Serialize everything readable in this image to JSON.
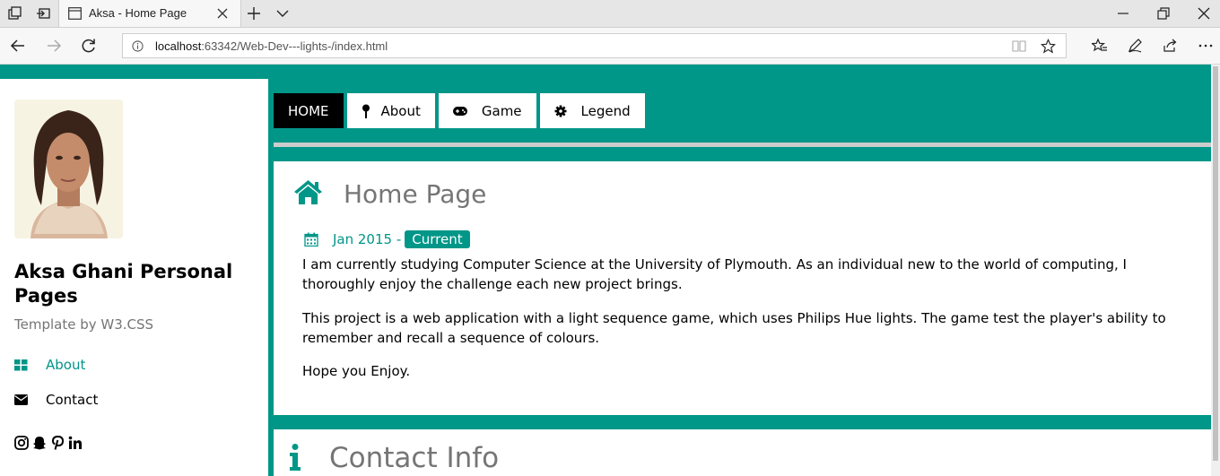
{
  "browser": {
    "tab_title": "Aksa - Home Page",
    "url_host": "localhost",
    "url_rest": ":63342/Web-Dev---lights-/index.html"
  },
  "colors": {
    "accent": "#009688",
    "muted": "#757575"
  },
  "sidebar": {
    "name": "Aksa Ghani Personal Pages",
    "subtitle": "Template by W3.CSS",
    "links": [
      {
        "label": "About",
        "icon": "grid-icon",
        "active": true
      },
      {
        "label": "Contact",
        "icon": "envelope-icon",
        "active": false
      }
    ],
    "social_icons": [
      "instagram-icon",
      "snapchat-icon",
      "pinterest-icon",
      "linkedin-icon"
    ]
  },
  "menu": {
    "items": [
      {
        "label": "HOME",
        "icon": "",
        "active": true
      },
      {
        "label": "About",
        "icon": "pin-icon",
        "active": false
      },
      {
        "label": "Game",
        "icon": "gamepad-icon",
        "active": false
      },
      {
        "label": "Legend",
        "icon": "gear-icon",
        "active": false
      }
    ]
  },
  "home": {
    "title": "Home Page",
    "date": "Jan 2015 -",
    "badge": "Current",
    "paragraphs": [
      "I am currently studying Computer Science at the University of Plymouth. As an individual new to the world of computing, I thoroughly enjoy the challenge each new project brings.",
      "This project is a web application with a light sequence game, which uses Philips Hue lights. The game test the player's ability to remember and recall a sequence of colours.",
      "Hope you Enjoy."
    ]
  },
  "contact": {
    "title": "Contact Info"
  }
}
